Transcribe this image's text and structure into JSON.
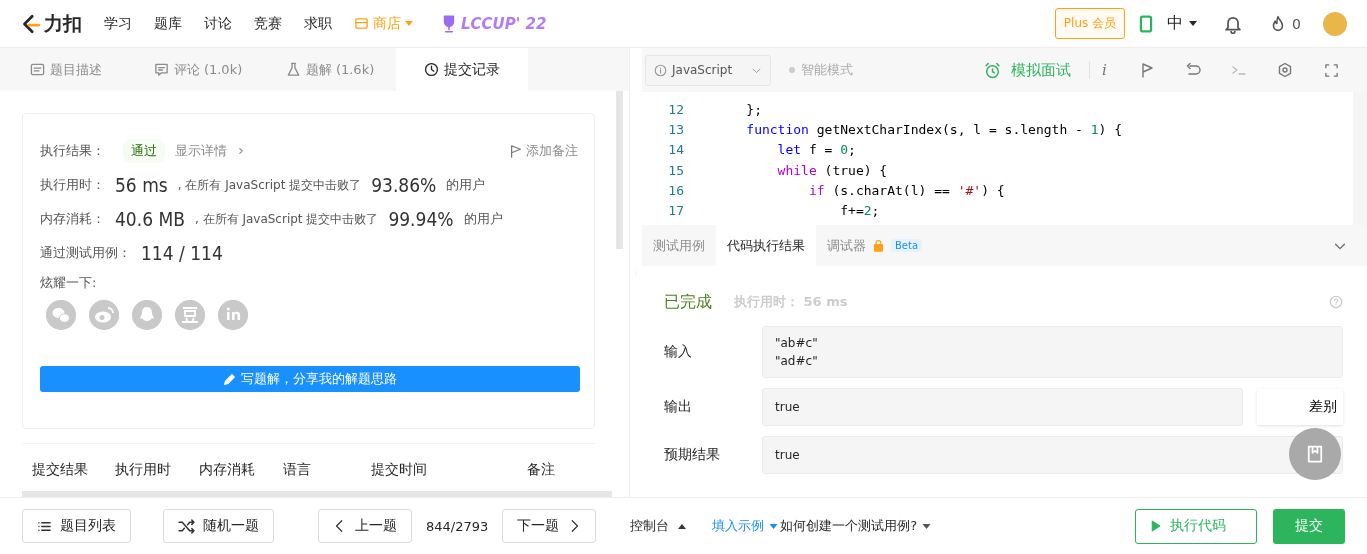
{
  "header": {
    "brand": "力扣",
    "nav": [
      {
        "label": "学习",
        "kind": "plain"
      },
      {
        "label": "题库",
        "kind": "plain"
      },
      {
        "label": "讨论",
        "kind": "plain"
      },
      {
        "label": "竞赛",
        "kind": "plain"
      },
      {
        "label": "求职",
        "kind": "plain"
      },
      {
        "label": "商店",
        "kind": "store"
      }
    ],
    "event": "LCCUP' 22",
    "plus": "Plus 会员",
    "language": "中",
    "points": "0"
  },
  "tabs": [
    {
      "label": "题目描述",
      "kind": "doc",
      "selected": false
    },
    {
      "label": "评论 (1.0k)",
      "kind": "comment",
      "selected": false
    },
    {
      "label": "题解 (1.6k)",
      "kind": "flask",
      "selected": false
    },
    {
      "label": "提交记录",
      "kind": "clock",
      "selected": true
    }
  ],
  "result": {
    "status_label": "执行结果：",
    "status": "通过",
    "details_link": "显示详情",
    "note_link": "添加备注",
    "stats": [
      {
        "label": "执行用时：",
        "value": "56 ms",
        "text": ", 在所有 JavaScript 提交中击败了",
        "percent": "93.86%",
        "suffix": "的用户"
      },
      {
        "label": "内存消耗：",
        "value": "40.6 MB",
        "text": ", 在所有 JavaScript 提交中击败了",
        "percent": "99.94%",
        "suffix": "的用户"
      }
    ],
    "cases_label": "通过测试用例：",
    "cases": "114 / 114",
    "share_label": "炫耀一下:",
    "write_button": "写题解，分享我的解题思路"
  },
  "table": {
    "columns": [
      "提交结果",
      "执行用时",
      "内存消耗",
      "语言",
      "提交时间",
      "备注"
    ]
  },
  "editor": {
    "language": "JavaScript",
    "smart_mode": {
      "label": "智能模式",
      "on": false
    },
    "interview": "模拟面试",
    "info": "i",
    "lines": [
      {
        "number": "12",
        "tokens": [
          {
            "text": "    };",
            "kind": "plain"
          }
        ]
      },
      {
        "number": "13",
        "tokens": [
          {
            "text": "    function",
            "kind": "keyword"
          },
          {
            "text": " getNextCharIndex(s, l = s.length - ",
            "kind": "plain"
          },
          {
            "text": "1",
            "kind": "number"
          },
          {
            "text": ") {",
            "kind": "plain"
          }
        ]
      },
      {
        "number": "14",
        "tokens": [
          {
            "text": "        let",
            "kind": "keyword"
          },
          {
            "text": " f = ",
            "kind": "plain"
          },
          {
            "text": "0",
            "kind": "number"
          },
          {
            "text": ";",
            "kind": "plain"
          }
        ]
      },
      {
        "number": "15",
        "tokens": [
          {
            "text": "        while",
            "kind": "control"
          },
          {
            "text": " (true) {",
            "kind": "plain"
          }
        ]
      },
      {
        "number": "16",
        "tokens": [
          {
            "text": "            if",
            "kind": "control"
          },
          {
            "text": " (s.charAt(l) == ",
            "kind": "plain"
          },
          {
            "text": "'#'",
            "kind": "string"
          },
          {
            "text": ") {",
            "kind": "plain"
          }
        ]
      },
      {
        "number": "17",
        "tokens": [
          {
            "text": "                f+=",
            "kind": "plain"
          },
          {
            "text": "2",
            "kind": "number"
          },
          {
            "text": ";",
            "kind": "plain"
          }
        ]
      }
    ]
  },
  "console": {
    "tabs": [
      {
        "label": "测试用例",
        "selected": false
      },
      {
        "label": "代码执行结果",
        "selected": true
      },
      {
        "label": "调试器",
        "selected": false,
        "badge": "Beta",
        "locked": true
      }
    ],
    "state": "已完成",
    "runtime": "执行用时： 56 ms",
    "fields": [
      {
        "label": "输入",
        "lines": [
          "\"ab#c\"",
          "\"ad#c\""
        ]
      },
      {
        "label": "输出",
        "lines": [
          "true"
        ],
        "diff": "差别"
      },
      {
        "label": "预期结果",
        "lines": [
          "true"
        ]
      }
    ]
  },
  "footer": {
    "list": "题目列表",
    "random": "随机一题",
    "prev": "上一题",
    "position": "844/2793",
    "next": "下一题",
    "console": "控制台",
    "fill_example": "填入示例",
    "how_to": "如何创建一个测试用例?",
    "run": "执行代码",
    "submit": "提交"
  }
}
